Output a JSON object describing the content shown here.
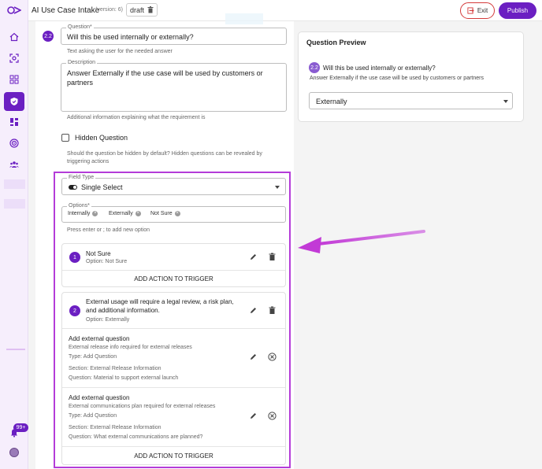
{
  "header": {
    "title": "AI Use Case Intake",
    "version": "(version: 6)",
    "draft_label": "draft",
    "exit_label": "Exit",
    "publish_label": "Publish"
  },
  "sidebar": {
    "badge": "99+",
    "items": [
      {
        "icon": "home-icon"
      },
      {
        "icon": "scan-icon"
      },
      {
        "icon": "apps-icon"
      },
      {
        "icon": "shield-icon",
        "active": true
      },
      {
        "icon": "dashboard-icon"
      },
      {
        "icon": "target-icon"
      },
      {
        "icon": "people-icon"
      }
    ]
  },
  "editor": {
    "question_number": "2.2",
    "question_label": "Question",
    "question_value": "Will this be used internally or externally?",
    "question_helper": "Text asking the user for the needed answer",
    "description_label": "Description",
    "description_value": "Answer Externally if the use case will be used by customers or partners",
    "description_helper": "Additional information explaining what the requirement is",
    "hidden_label": "Hidden Question",
    "hidden_helper": "Should the question be hidden by default? Hidden questions can be revealed by triggering actions",
    "field_type_label": "Field Type",
    "field_type_value": "Single Select",
    "options_label": "Options",
    "options": [
      "Internally",
      "Externally",
      "Not Sure"
    ],
    "options_helper": "Press enter or ; to add new option",
    "cards": [
      {
        "number": "1",
        "title": "Not Sure",
        "option": "Option: Not Sure",
        "trigger": "ADD ACTION TO TRIGGER",
        "actions": []
      },
      {
        "number": "2",
        "title_lines": [
          "External usage will require a legal review, a risk plan,",
          "and additional information."
        ],
        "option": "Option: Externally",
        "actions": [
          {
            "title": "Add external question",
            "desc": "External release info required for external releases",
            "type": "Type: Add Question",
            "section": "Section: External Release Information",
            "question": "Question: Material to support external launch"
          },
          {
            "title": "Add external question",
            "desc": "External communications plan required for external releases",
            "type": "Type: Add Question",
            "section": "Section: External Release Information",
            "question": "Question: What external communications are planned?"
          }
        ],
        "trigger": "ADD ACTION TO TRIGGER"
      }
    ]
  },
  "preview": {
    "title": "Question Preview",
    "number": "2.2",
    "question": "Will this be used internally or externally?",
    "description": "Answer Externally if the use case will be used by customers or partners",
    "selected": "Externally"
  },
  "colors": {
    "accent": "#6b1fc2",
    "highlight": "#b43cd8",
    "arrow": "#c23ad6"
  }
}
